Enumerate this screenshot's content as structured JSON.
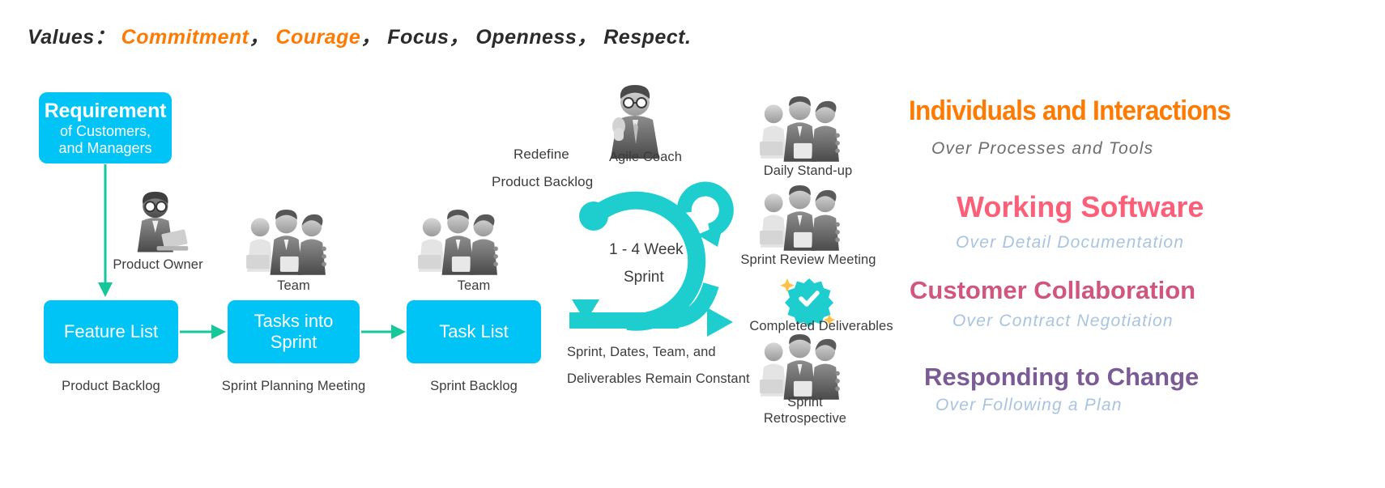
{
  "values_header": {
    "label": "Values",
    "colon": "：",
    "items": [
      {
        "text": "Commitment",
        "color": "#FF7A00"
      },
      {
        "text": "Courage",
        "color": "#FF7A00"
      },
      {
        "text": "Focus",
        "color": "#2b2b2b"
      },
      {
        "text": "Openness",
        "color": "#2b2b2b"
      },
      {
        "text": "Respect",
        "color": "#2b2b2b"
      }
    ],
    "separator": "，",
    "period": "."
  },
  "flow": {
    "requirement_box": {
      "title": "Requirement",
      "subtitle": "of Customers,\nand Managers",
      "subtitle_line1": "of Customers,",
      "subtitle_line2": "and Managers",
      "color": "#00C4F5"
    },
    "boxes": [
      {
        "label": "Feature List",
        "caption": "Product Backlog"
      },
      {
        "label_line1": "Tasks into",
        "label_line2": "Sprint",
        "caption": "Sprint Planning Meeting"
      },
      {
        "label": "Task List",
        "caption": "Sprint Backlog"
      }
    ],
    "roles": [
      {
        "name": "Product Owner"
      },
      {
        "name": "Team"
      },
      {
        "name": "Team"
      }
    ]
  },
  "sprint_cycle": {
    "redefine_line1": "Redefine",
    "redefine_line2": "Product Backlog",
    "duration_line1": "1 - 4 Week",
    "duration_line2": "Sprint",
    "constant_line1": "Sprint, Dates, Team, and",
    "constant_line2": "Deliverables Remain Constant",
    "arrow_color": "#1ECECE"
  },
  "participants": [
    {
      "name": "Agile Coach"
    },
    {
      "name": "Daily Stand-up"
    },
    {
      "name": "Sprint Review Meeting"
    },
    {
      "name": "Completed Deliverables"
    },
    {
      "name_line1": "Sprint",
      "name_line2": "Retrospective"
    }
  ],
  "manifesto": [
    {
      "main": "Individuals and Interactions",
      "sub": "Over  Processes  and  Tools",
      "main_color": "#FF7A00",
      "sub_color": "#6e6e6e"
    },
    {
      "main": "Working Software",
      "sub": "Over  Detail  Documentation",
      "main_color": "#FC5F77",
      "sub_color": "#A8C4E0"
    },
    {
      "main": "Customer Collaboration",
      "sub": "Over  Contract  Negotiation",
      "main_color": "#D0567F",
      "sub_color": "#A8C4E0"
    },
    {
      "main": "Responding to Change",
      "sub": "Over  Following  a  Plan",
      "main_color": "#7B5B95",
      "sub_color": "#A8C4E0"
    }
  ],
  "colors": {
    "box_blue": "#00C4F5",
    "arrow_teal": "#1ECECE",
    "arrow_green": "#16C79A",
    "badge_teal": "#1ECECE",
    "sparkle_gold": "#FFC247"
  }
}
